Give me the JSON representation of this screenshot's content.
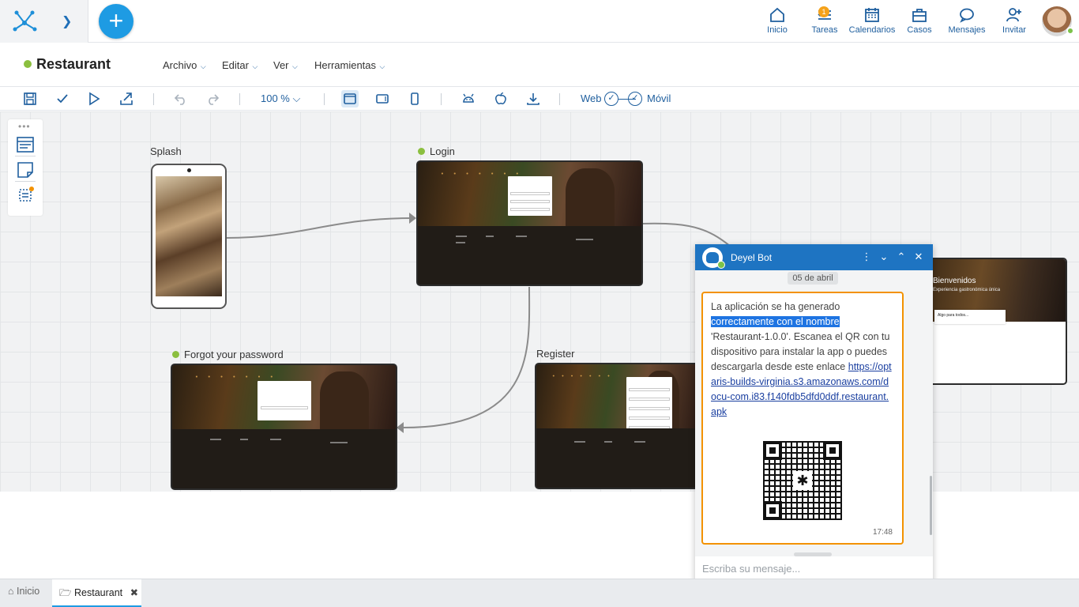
{
  "app": {
    "title": "Restaurant",
    "status_color": "#8bbf3f",
    "accent": "#1e74c2"
  },
  "header": {
    "nav": [
      {
        "label": "Inicio",
        "icon": "home-icon"
      },
      {
        "label": "Tareas",
        "icon": "tasks-icon",
        "badge": "1"
      },
      {
        "label": "Calendarios",
        "icon": "calendar-icon"
      },
      {
        "label": "Casos",
        "icon": "briefcase-icon"
      },
      {
        "label": "Mensajes",
        "icon": "chat-icon"
      },
      {
        "label": "Invitar",
        "icon": "add-user-icon"
      }
    ]
  },
  "menu": {
    "items": [
      "Archivo",
      "Editar",
      "Ver",
      "Herramientas"
    ]
  },
  "toolbar": {
    "zoom": "100 %",
    "web_label": "Web",
    "mobile_label": "Móvil"
  },
  "canvas": {
    "nodes": {
      "splash": "Splash",
      "login": "Login",
      "forgot": "Forgot your password",
      "register": "Register",
      "home_title": "Bienvenidos",
      "home_subtitle": "Experiencia gastronómica única",
      "home_card": "Algo para todos..."
    }
  },
  "chat": {
    "title": "Deyel Bot",
    "date": "05 de abril",
    "message_pre": "La aplicación se ha generado",
    "message_highlight": "correctamente con el nombre",
    "message_post": "'Restaurant-1.0.0'. Escanea el QR con tu dispositivo para instalar la app o puedes descargarla desde este enlace",
    "link": "https://optaris-builds-virginia.s3.amazonaws.com/docu-com.i83.f140fdb5dfd0ddf.restaurant.apk",
    "time": "17:48",
    "input_placeholder": "Escriba su mensaje..."
  },
  "tabs": [
    {
      "label": "Inicio",
      "active": false
    },
    {
      "label": "Restaurant",
      "active": true
    }
  ]
}
